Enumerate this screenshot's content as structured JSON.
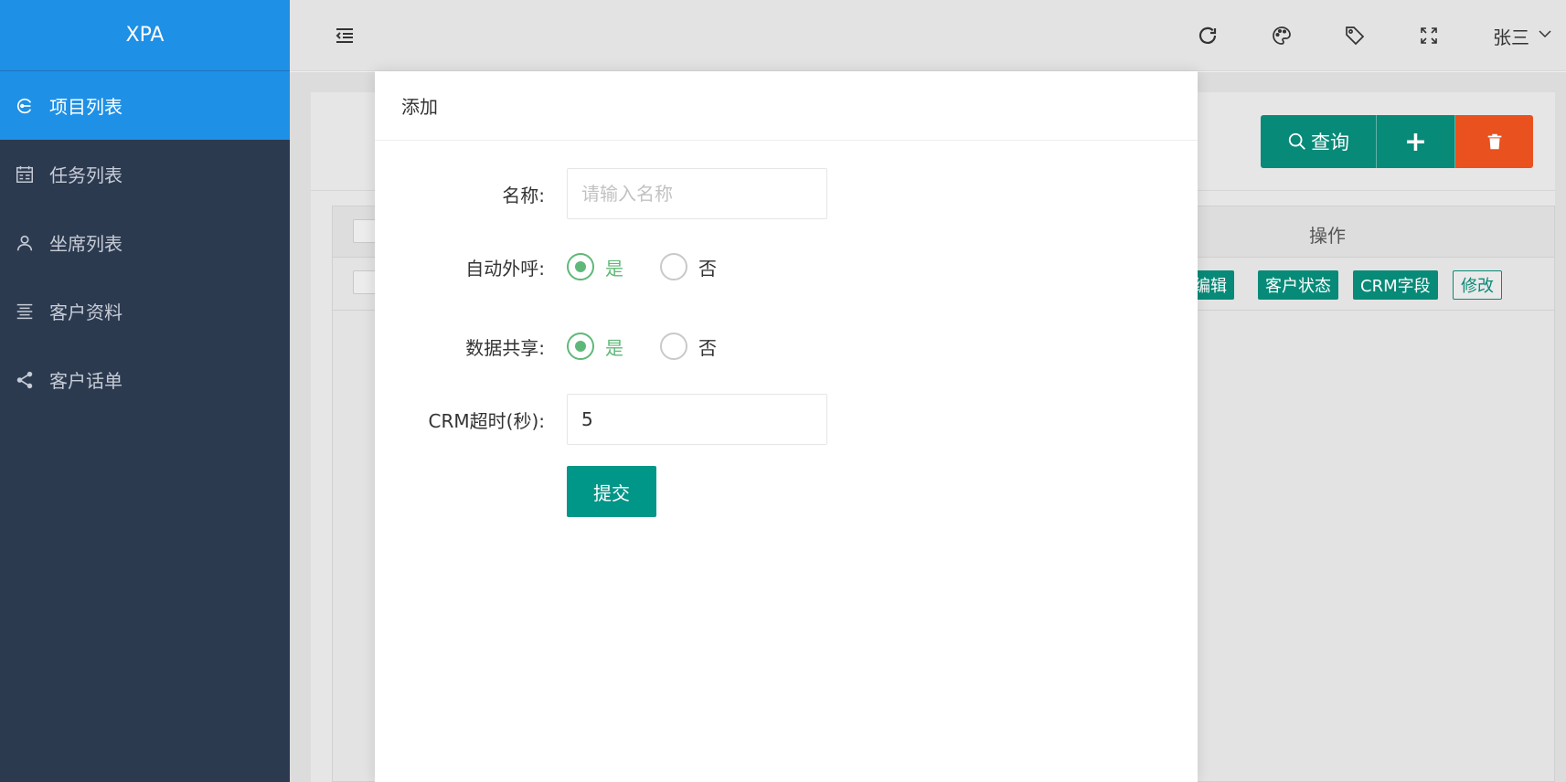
{
  "app": {
    "logo": "XPA"
  },
  "sidebar": {
    "items": [
      {
        "label": "项目列表",
        "icon": "project-icon",
        "active": true
      },
      {
        "label": "任务列表",
        "icon": "calendar-icon",
        "active": false
      },
      {
        "label": "坐席列表",
        "icon": "user-icon",
        "active": false
      },
      {
        "label": "客户资料",
        "icon": "align-icon",
        "active": false
      },
      {
        "label": "客户话单",
        "icon": "share-icon",
        "active": false
      }
    ]
  },
  "topbar": {
    "menu_icon": "menu-fold-icon",
    "icons": [
      "refresh-icon",
      "palette-icon",
      "tag-icon",
      "fullscreen-icon"
    ],
    "user": "张三"
  },
  "toolbar": {
    "query_label": "查询",
    "add_label": "+",
    "delete_icon": "trash-icon"
  },
  "table": {
    "header_op": "操作",
    "row_actions": [
      "编辑",
      "客户状态",
      "CRM字段",
      "修改"
    ]
  },
  "modal": {
    "title": "添加",
    "fields": {
      "name_label": "名称:",
      "name_placeholder": "请输入名称",
      "name_value": "",
      "auto_call_label": "自动外呼:",
      "auto_call_yes": "是",
      "auto_call_no": "否",
      "auto_call_selected": "是",
      "share_label": "数据共享:",
      "share_yes": "是",
      "share_no": "否",
      "share_selected": "是",
      "crm_timeout_label": "CRM超时(秒):",
      "crm_timeout_value": "5"
    },
    "submit_label": "提交"
  },
  "colors": {
    "sidebar_bg": "#2c3a50",
    "accent_blue": "#1e90e6",
    "teal": "#009688",
    "danger": "#e9511e",
    "radio_green": "#5fb878"
  }
}
